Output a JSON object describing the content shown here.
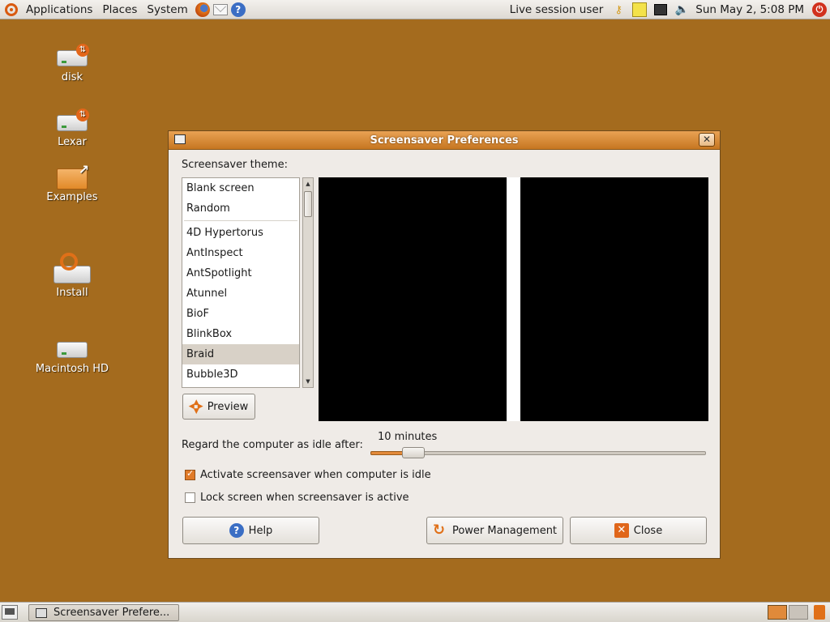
{
  "top_panel": {
    "menus": [
      "Applications",
      "Places",
      "System"
    ],
    "user": "Live session user",
    "clock": "Sun May  2,  5:08 PM"
  },
  "desktop": {
    "icons": [
      "disk",
      "Lexar",
      "Examples",
      "Install",
      "Macintosh HD"
    ]
  },
  "dialog": {
    "title": "Screensaver Preferences",
    "theme_label": "Screensaver theme:",
    "themes_top": [
      "Blank screen",
      "Random"
    ],
    "themes": [
      "4D Hypertorus",
      "AntInspect",
      "AntSpotlight",
      "Atunnel",
      "BioF",
      "BlinkBox",
      "Braid",
      "Bubble3D"
    ],
    "selected_theme": "Braid",
    "preview_button": "Preview",
    "idle_label": "Regard the computer as idle after:",
    "idle_value": "10 minutes",
    "idle_fraction": 0.1,
    "activate_label": "Activate screensaver when computer is idle",
    "activate_checked": true,
    "lock_label": "Lock screen when screensaver is active",
    "lock_checked": false,
    "help_button": "Help",
    "power_button": "Power Management",
    "close_button": "Close"
  },
  "bottom_panel": {
    "task": "Screensaver Prefere..."
  },
  "colors": {
    "desktop": "#a46b1e",
    "accent": "#e07018"
  }
}
